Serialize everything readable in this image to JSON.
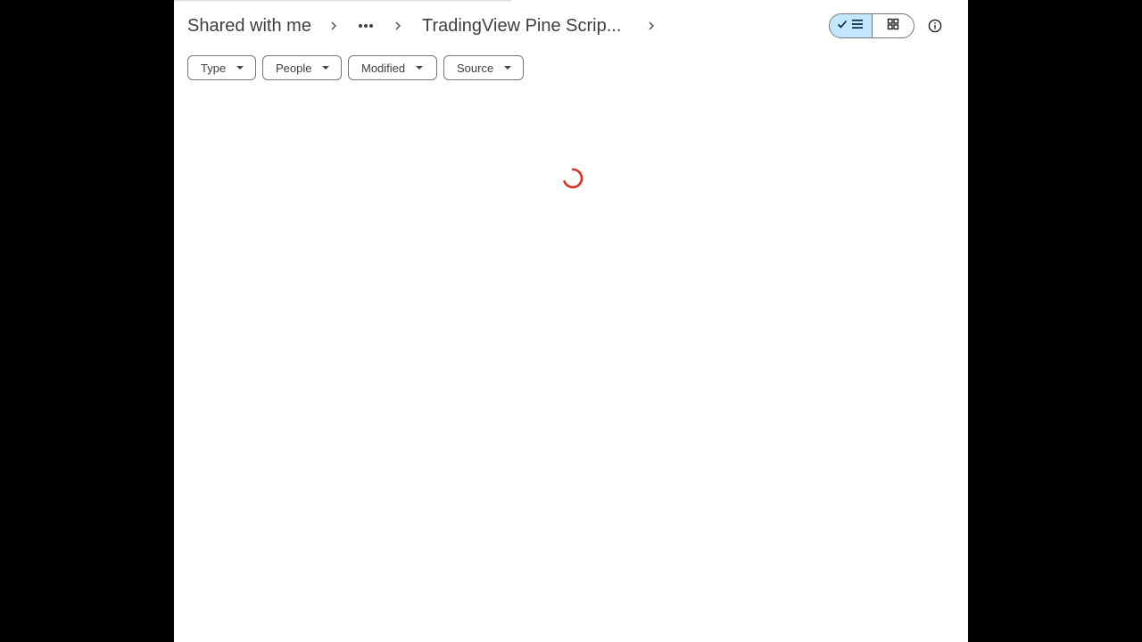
{
  "breadcrumb": {
    "root": "Shared with me",
    "current": "TradingView Pine Scrip..."
  },
  "icons": {
    "chevron": "chevron-right-icon",
    "more": "more-horiz-icon",
    "list_view": "list-view-icon",
    "grid_view": "grid-view-icon",
    "checkmark": "check-icon",
    "info": "info-icon"
  },
  "filters": [
    {
      "label": "Type"
    },
    {
      "label": "People"
    },
    {
      "label": "Modified"
    },
    {
      "label": "Source"
    }
  ],
  "view": {
    "active": "list"
  },
  "colors": {
    "toggle_active_bg": "#c2e7ff",
    "spinner": "#d93025",
    "text": "#3c4043"
  }
}
